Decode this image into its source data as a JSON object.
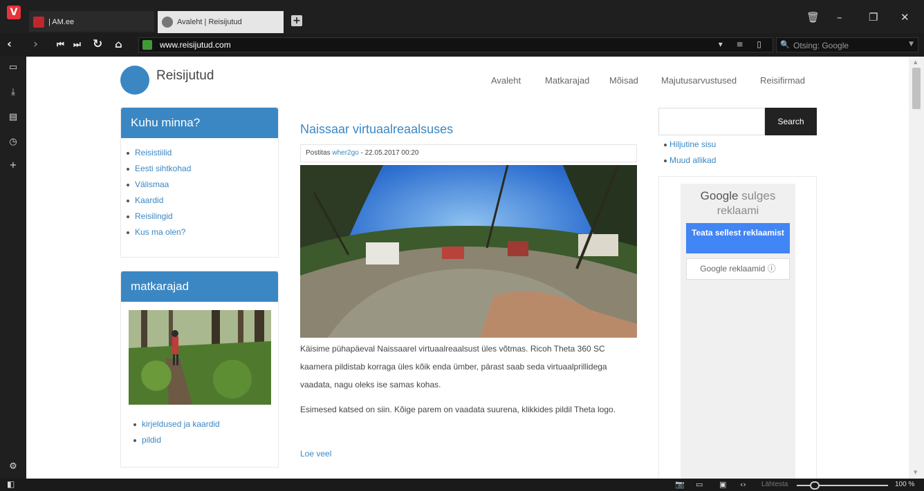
{
  "browser": {
    "tabs": [
      {
        "title": "| AM.ee",
        "active": false
      },
      {
        "title": "Avaleht | Reisijutud",
        "active": true
      }
    ],
    "new_tab_label": "+",
    "address": "www.reisijutud.com",
    "search_placeholder": "Otsing: Google",
    "zoom": "100 %",
    "zoom_reset_label": "Lähtesta",
    "window_buttons": {
      "trash": "trash-icon",
      "minimize": "minimize-icon",
      "restore": "restore-icon",
      "close": "close-icon"
    },
    "colors": {
      "chrome": "#1f1f1f",
      "logo": "#e8333a",
      "lock": "#3f9c35"
    }
  },
  "site": {
    "title": "Reisijutud",
    "nav": [
      "Avaleht",
      "Matkarajad",
      "Mõisad",
      "Majutusarvustused",
      "Reisifirmad"
    ],
    "colors": {
      "accent": "#3a87c4"
    }
  },
  "sidebar": {
    "widget1": {
      "title": "Kuhu minna?",
      "links": [
        "Reisistiilid",
        "Eesti sihtkohad",
        "Välismaa",
        "Kaardid",
        "Reisilingid",
        "Kus ma olen?"
      ]
    },
    "widget2": {
      "title": "matkarajad",
      "links": [
        "kirjeldused ja kaardid",
        "pildid"
      ]
    }
  },
  "post": {
    "title": "Naissaar virtuaalreaalsuses",
    "meta_prefix": "Postitas",
    "author": "wher2go",
    "meta_date": "- 22.05.2017 00:20",
    "paragraph1": "Käisime pühapäeval Naissaarel virtuaalreaalsust üles võtmas. Ricoh Theta 360 SC kaamera pildistab korraga üles kõik enda ümber, pärast saab seda virtuaalprillidega vaadata, nagu oleks ise samas kohas.",
    "paragraph2": "Esimesed katsed on siin. Kõige parem on vaadata suurena, klikkides pildil Theta logo.",
    "read_more": "Loe veel"
  },
  "right": {
    "search_button": "Search",
    "links": [
      "Hiljutine sisu",
      "Muud allikad"
    ],
    "ad": {
      "google": "Google",
      "closes": "sulges",
      "closes2": "reklaami",
      "report_button": "Teata sellest reklaamist",
      "why_button": "Google reklaamid ⓘ"
    }
  }
}
